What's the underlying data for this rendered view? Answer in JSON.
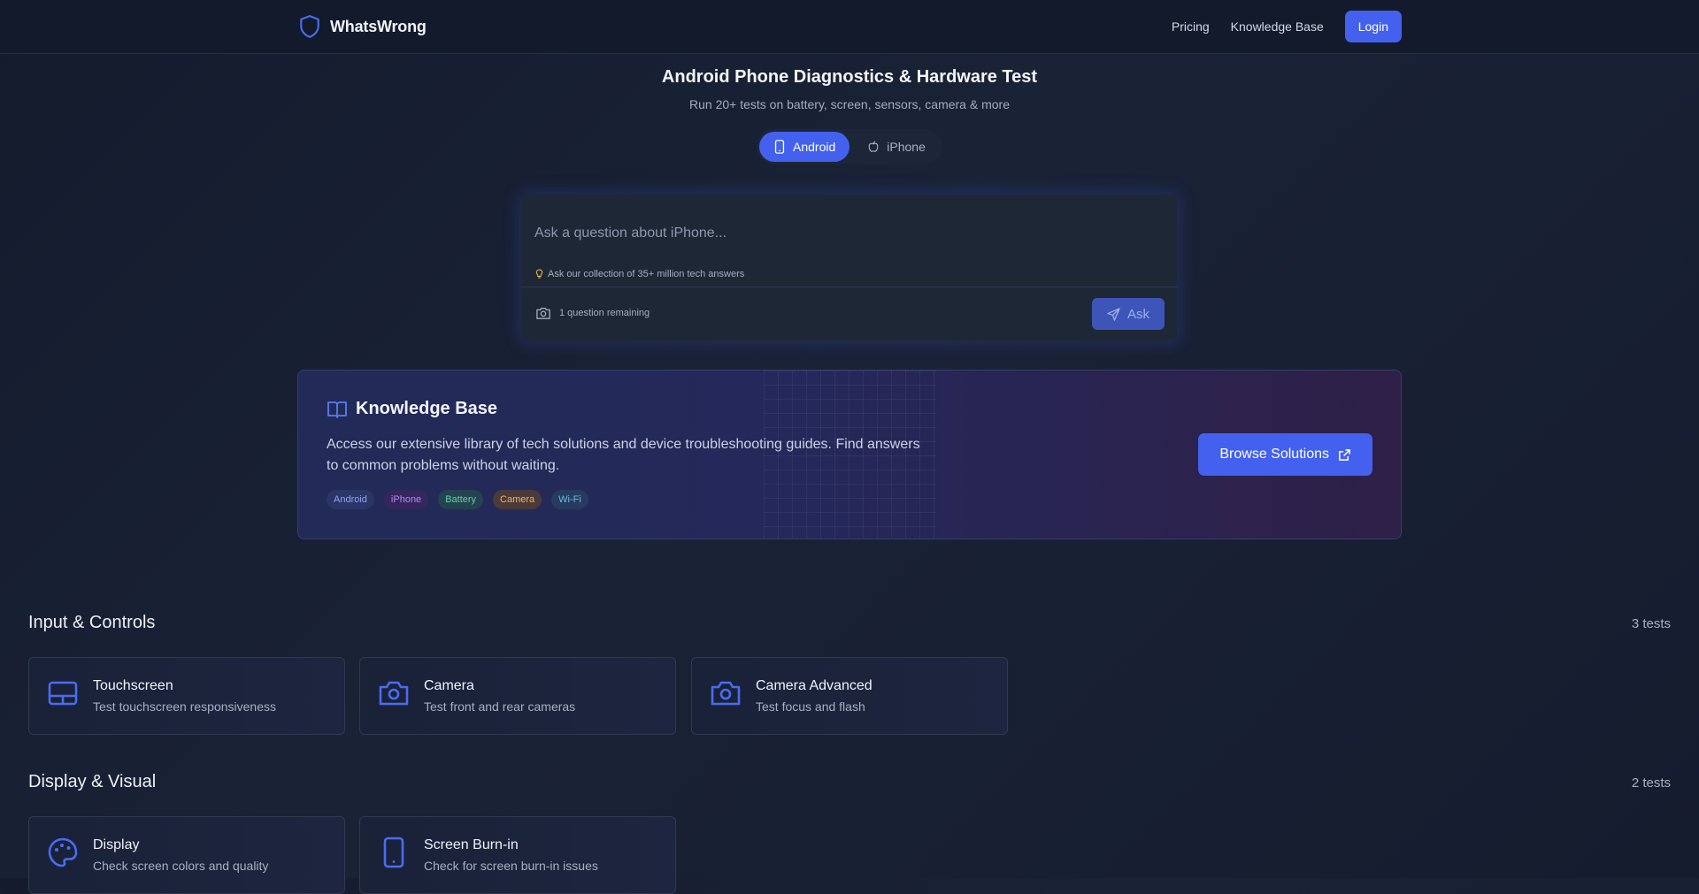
{
  "header": {
    "brand": "WhatsWrong",
    "nav": [
      "Pricing",
      "Knowledge Base"
    ],
    "login": "Login"
  },
  "hero": {
    "title": "Android Phone Diagnostics & Hardware Test",
    "subtitle": "Run 20+ tests on battery, screen, sensors, camera & more"
  },
  "platform_toggle": {
    "options": [
      "Android",
      "iPhone"
    ],
    "selected": "Android"
  },
  "ask_box": {
    "placeholder": "Ask a question about iPhone...",
    "value": "",
    "hint": "Ask our collection of 35+ million tech answers",
    "remaining": "1 question remaining",
    "ask_label": "Ask"
  },
  "knowledge_base": {
    "title": "Knowledge Base",
    "description": "Access our extensive library of tech solutions and device troubleshooting guides. Find answers to common problems without waiting.",
    "tags": [
      {
        "label": "Android",
        "bg": "#2b3566",
        "fg": "#8fa4f2"
      },
      {
        "label": "iPhone",
        "bg": "#35265e",
        "fg": "#b48af2"
      },
      {
        "label": "Battery",
        "bg": "#24424f",
        "fg": "#5fd0a4"
      },
      {
        "label": "Camera",
        "bg": "#4a3a3a",
        "fg": "#f0b35a"
      },
      {
        "label": "Wi-Fi",
        "bg": "#263c5e",
        "fg": "#6fb8ea"
      }
    ],
    "browse_label": "Browse Solutions"
  },
  "sections": [
    {
      "title": "Input & Controls",
      "count": "3 tests",
      "tests": [
        {
          "title": "Touchscreen",
          "desc": "Test touchscreen responsiveness",
          "icon": "tablet-icon"
        },
        {
          "title": "Camera",
          "desc": "Test front and rear cameras",
          "icon": "camera-icon"
        },
        {
          "title": "Camera Advanced",
          "desc": "Test focus and flash",
          "icon": "camera-icon"
        }
      ]
    },
    {
      "title": "Display & Visual",
      "count": "2 tests",
      "tests": [
        {
          "title": "Display",
          "desc": "Check screen colors and quality",
          "icon": "palette-icon"
        },
        {
          "title": "Screen Burn-in",
          "desc": "Check for screen burn-in issues",
          "icon": "phone-icon"
        }
      ]
    }
  ],
  "colors": {
    "accent": "#4361ee",
    "background": "#161d2e",
    "icon": "#4a6cf0"
  }
}
